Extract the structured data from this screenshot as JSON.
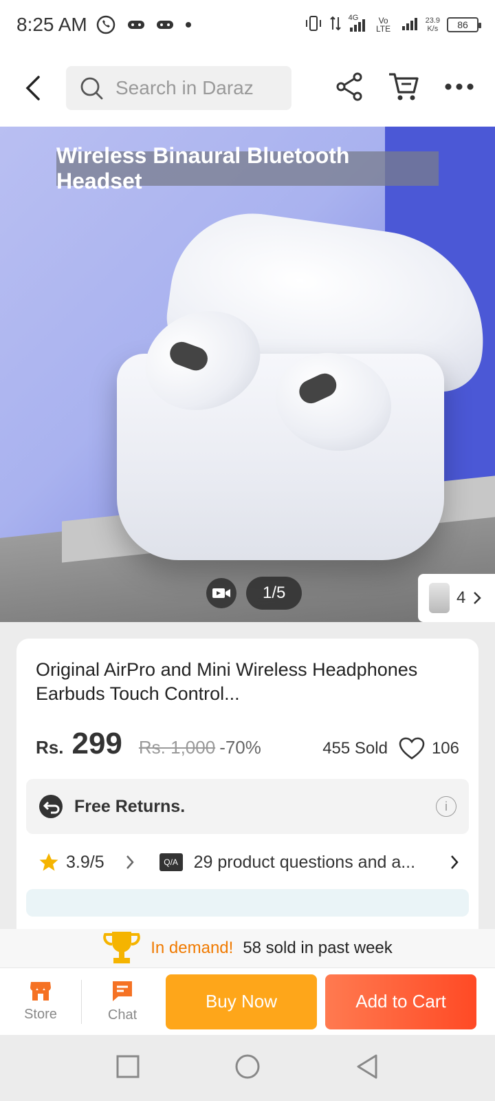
{
  "status_bar": {
    "time": "8:25 AM",
    "speed_value": "23.9",
    "speed_unit": "K/s",
    "battery": "86",
    "network_4g": "4G",
    "network_volte": "Vo LTE"
  },
  "top_bar": {
    "search_placeholder": "Search in Daraz"
  },
  "gallery": {
    "headline": "Wireless Binaural Bluetooth Headset",
    "counter": "1/5",
    "more_count": "4"
  },
  "product": {
    "title": "Original AirPro and Mini Wireless Headphones Earbuds Touch Control...",
    "currency": "Rs.",
    "price": "299",
    "original_price": "Rs. 1,000",
    "discount": "-70%",
    "sold": "455 Sold",
    "wishlist_count": "106",
    "returns_label": "Free Returns.",
    "rating": "3.9/5",
    "qa_badge": "Q/A",
    "qa_text": "29 product questions and a..."
  },
  "demand": {
    "hot_label": "In demand!",
    "text": "58 sold in past week"
  },
  "bottom_bar": {
    "store_label": "Store",
    "chat_label": "Chat",
    "buy_now_label": "Buy Now",
    "add_to_cart_label": "Add to Cart"
  },
  "colors": {
    "accent_orange": "#f07a00",
    "buy_now": "#fea61a",
    "add_to_cart": "#ff4a25"
  }
}
